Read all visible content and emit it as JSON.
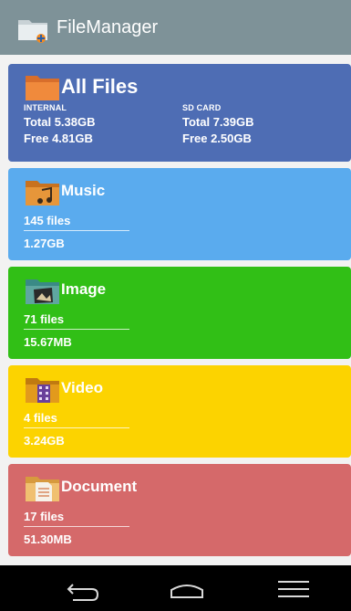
{
  "app": {
    "title": "FileManager",
    "icon": "folder-app-icon"
  },
  "cards": {
    "all_files": {
      "title": "All Files",
      "color": "#4e6db4",
      "internal": {
        "caption": "INTERNAL",
        "total": "Total 5.38GB",
        "free": "Free 4.81GB"
      },
      "sdcard": {
        "caption": "SD CARD",
        "total": "Total 7.39GB",
        "free": "Free 2.50GB"
      }
    },
    "music": {
      "title": "Music",
      "color": "#5aabee",
      "count": "145 files",
      "size": "1.27GB"
    },
    "image": {
      "title": "Image",
      "color": "#31bf16",
      "count": "71 files",
      "size": "15.67MB"
    },
    "video": {
      "title": "Video",
      "color": "#fcd300",
      "count": "4 files",
      "size": "3.24GB"
    },
    "document": {
      "title": "Document",
      "color": "#d5696a",
      "count": "17 files",
      "size": "51.30MB"
    }
  },
  "navbar": {
    "back": "back-icon",
    "home": "home-icon",
    "recents": "recents-icon"
  }
}
